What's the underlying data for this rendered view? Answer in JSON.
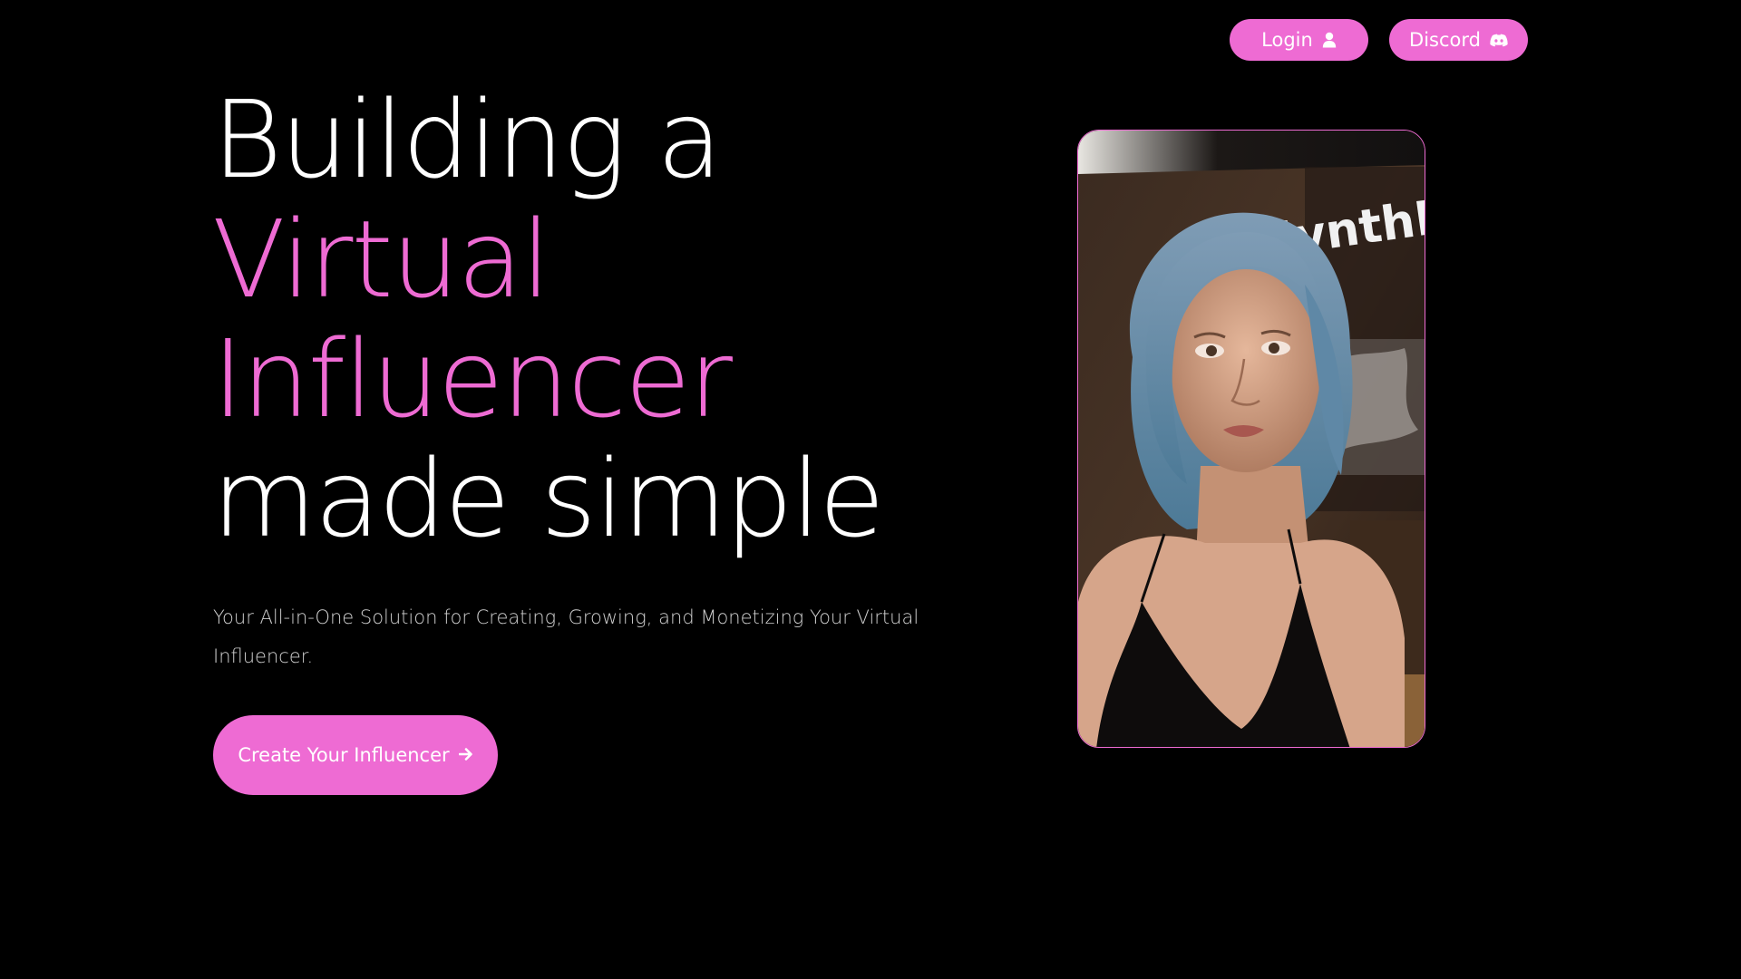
{
  "nav": {
    "login_label": "Login",
    "login_icon": "user-icon",
    "discord_label": "Discord",
    "discord_icon": "discord-icon"
  },
  "hero": {
    "headline": {
      "line1": "Building a",
      "line2": "Virtual",
      "line3": "Influencer",
      "line4": "made simple"
    },
    "subtitle": "Your All-in-One Solution for Creating, Growing, and Monetizing Your Virtual Influencer.",
    "cta_label": "Create Your Influencer",
    "cta_icon": "arrow-right-icon",
    "portrait_sign_text": "SynthL"
  },
  "colors": {
    "background": "#000000",
    "accent": "#ee6bd3",
    "text": "#ffffff",
    "muted_text": "#cfcfcf"
  }
}
